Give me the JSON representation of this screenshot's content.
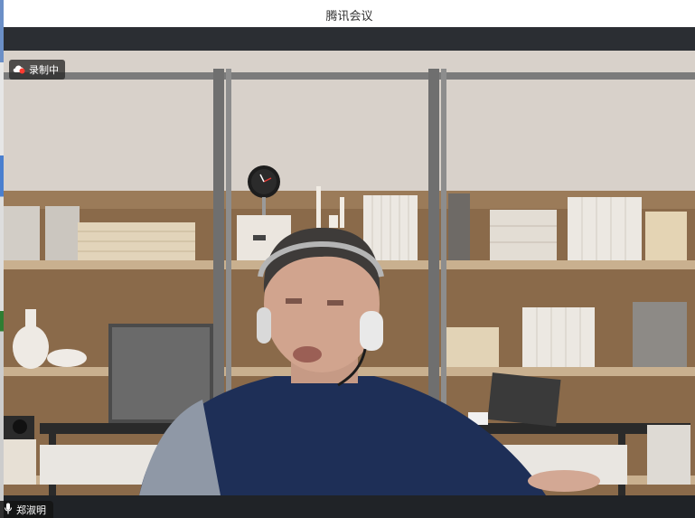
{
  "window": {
    "title": "腾讯会议"
  },
  "recording": {
    "label": "录制中",
    "icon": "cloud-record-icon"
  },
  "participant": {
    "name": "郑淑明",
    "mic_icon": "microphone-icon"
  },
  "colors": {
    "titlebar": "#ffffff",
    "chrome": "#23262b",
    "badge": "#282828",
    "recording_icon": "#ff3b30"
  }
}
